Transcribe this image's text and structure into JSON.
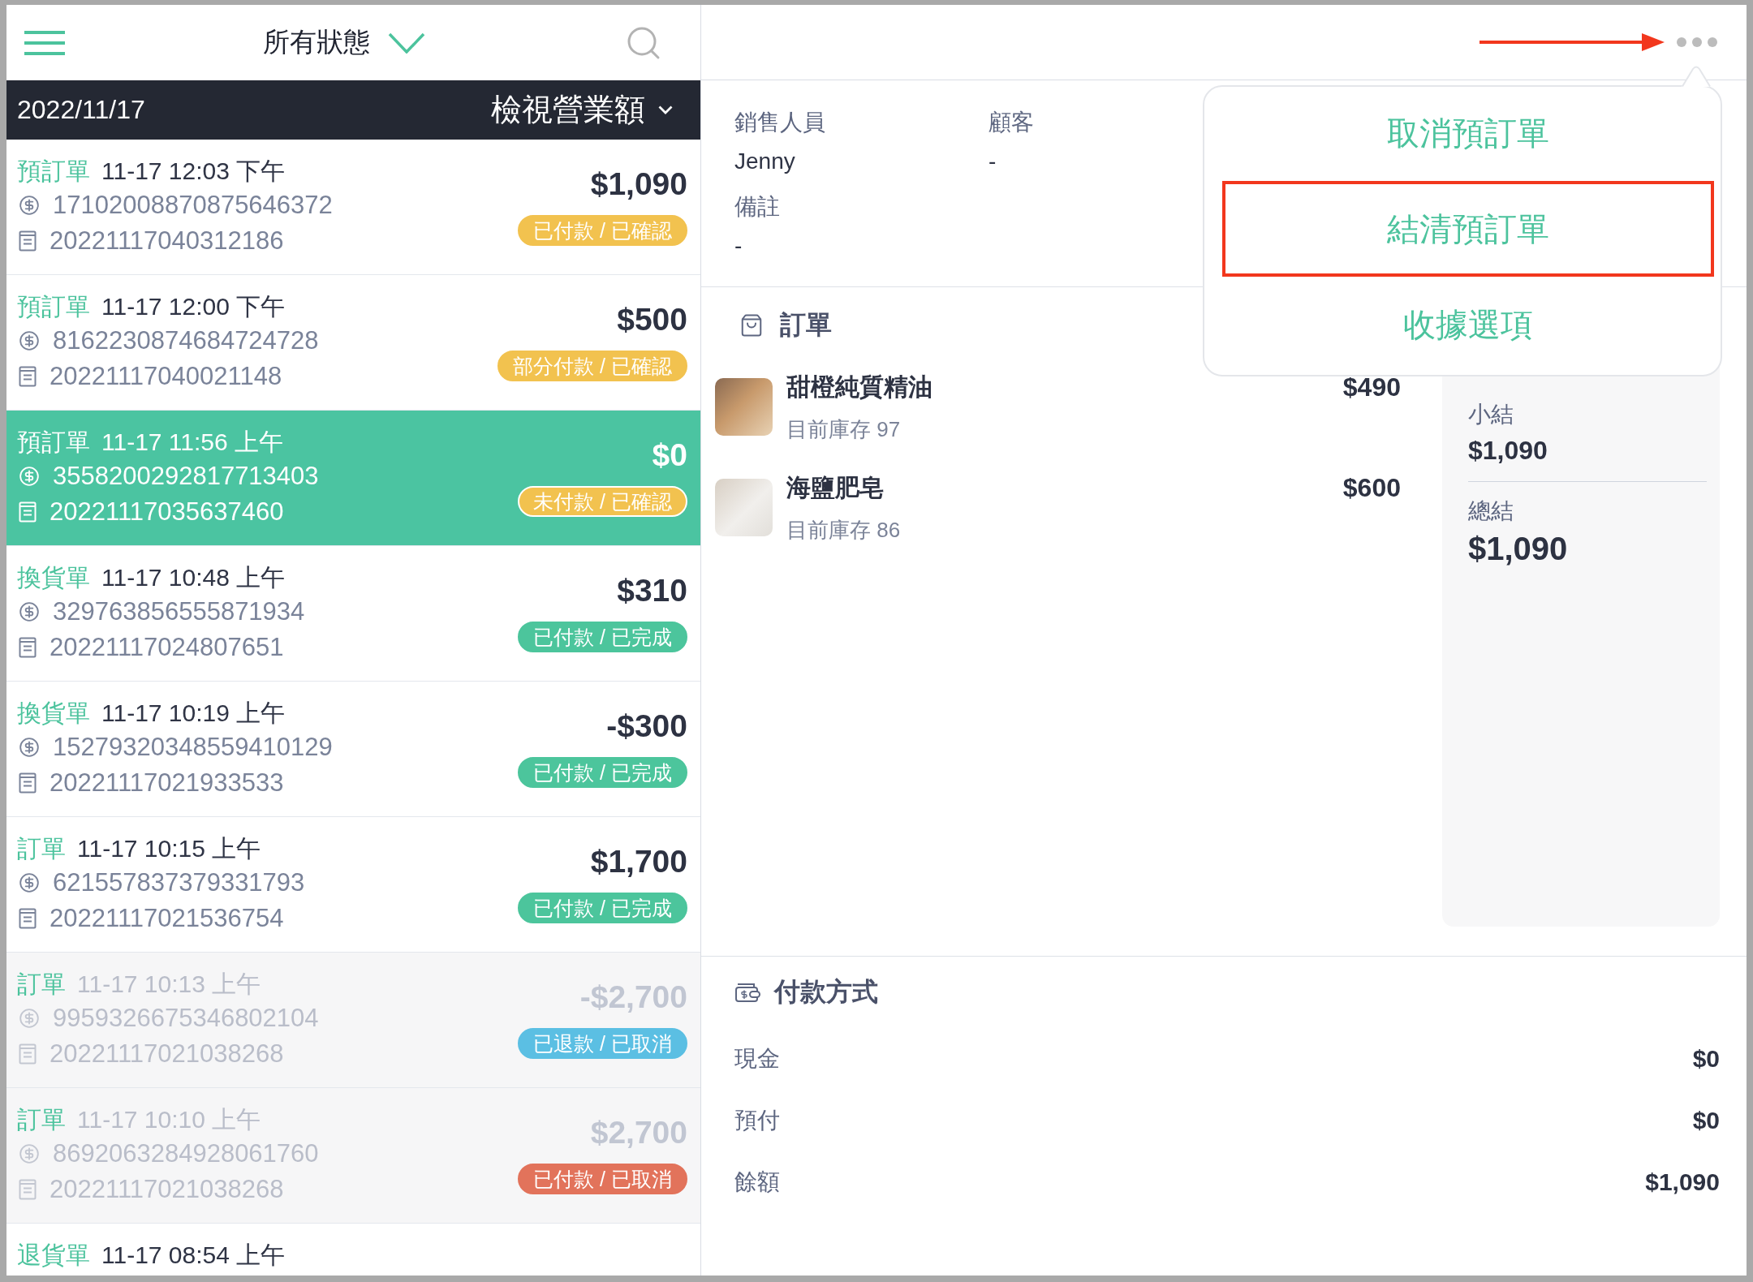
{
  "header": {
    "filter_label": "所有狀態"
  },
  "date_bar": {
    "date": "2022/11/17",
    "revenue_button": "檢視營業額"
  },
  "orders": [
    {
      "kind_label": "預訂單",
      "time": "11-17 12:03 下午",
      "payment_number": "17102008870875646372",
      "receipt_number": "20221117040312186",
      "amount": "$1,090",
      "status": {
        "text": "已付款 / 已確認",
        "color": "#f2c24f"
      },
      "selected": false,
      "disabled": false
    },
    {
      "kind_label": "預訂單",
      "time": "11-17 12:00 下午",
      "payment_number": "8162230874684724728",
      "receipt_number": "20221117040021148",
      "amount": "$500",
      "status": {
        "text": "部分付款 / 已確認",
        "color": "#f2c24f"
      },
      "selected": false,
      "disabled": false
    },
    {
      "kind_label": "預訂單",
      "time": "11-17 11:56 上午",
      "payment_number": "3558200292817713403",
      "receipt_number": "20221117035637460",
      "amount": "$0",
      "status": {
        "text": "未付款 / 已確認",
        "color": "#f2c24f"
      },
      "selected": true,
      "disabled": false
    },
    {
      "kind_label": "換貨單",
      "time": "11-17 10:48 上午",
      "payment_number": "329763856555871934",
      "receipt_number": "20221117024807651",
      "amount": "$310",
      "status": {
        "text": "已付款 / 已完成",
        "color": "#4cc59c"
      },
      "selected": false,
      "disabled": false
    },
    {
      "kind_label": "換貨單",
      "time": "11-17 10:19 上午",
      "payment_number": "15279320348559410129",
      "receipt_number": "20221117021933533",
      "amount": "-$300",
      "status": {
        "text": "已付款 / 已完成",
        "color": "#4cc59c"
      },
      "selected": false,
      "disabled": false
    },
    {
      "kind_label": "訂單",
      "time": "11-17 10:15 上午",
      "payment_number": "621557837379331793",
      "receipt_number": "20221117021536754",
      "amount": "$1,700",
      "status": {
        "text": "已付款 / 已完成",
        "color": "#4cc59c"
      },
      "selected": false,
      "disabled": false
    },
    {
      "kind_label": "訂單",
      "time": "11-17 10:13 上午",
      "payment_number": "9959326675346802104",
      "receipt_number": "20221117021038268",
      "amount": "-$2,700",
      "status": {
        "text": "已退款 / 已取消",
        "color": "#5bbfe3"
      },
      "selected": false,
      "disabled": true
    },
    {
      "kind_label": "訂單",
      "time": "11-17 10:10 上午",
      "payment_number": "8692063284928061760",
      "receipt_number": "20221117021038268",
      "amount": "$2,700",
      "status": {
        "text": "已付款 / 已取消",
        "color": "#e2735b"
      },
      "selected": false,
      "disabled": true
    },
    {
      "kind_label": "退貨單",
      "time": "11-17 08:54 上午",
      "selected": false,
      "disabled": false
    }
  ],
  "more_menu": {
    "annotated": true
  },
  "details": {
    "fields": [
      {
        "label": "銷售人員",
        "value": "Jenny"
      },
      {
        "label": "顧客",
        "value": "-"
      },
      {
        "label": "備註",
        "value": "-"
      }
    ]
  },
  "order_section": {
    "title": "訂單",
    "items": [
      {
        "name": "甜橙純質精油",
        "stock": "目前庫存 97",
        "price": "$490"
      },
      {
        "name": "海鹽肥皂",
        "stock": "目前庫存 86",
        "price": "$600"
      }
    ]
  },
  "summary": {
    "rows": [
      {
        "kind": "subtotal",
        "label": "小結",
        "value": "$1,090"
      },
      {
        "kind": "total",
        "label": "總結",
        "value": "$1,090"
      }
    ]
  },
  "payment_section": {
    "title": "付款方式",
    "rows": [
      {
        "label": "現金",
        "value": "$0"
      },
      {
        "label": "預付",
        "value": "$0"
      },
      {
        "label": "餘額",
        "value": "$1,090"
      }
    ]
  },
  "menu": {
    "items": [
      {
        "label": "取消預訂單",
        "highlighted": false
      },
      {
        "label": "結清預訂單",
        "highlighted": true
      },
      {
        "label": "收據選項",
        "highlighted": false
      }
    ]
  }
}
